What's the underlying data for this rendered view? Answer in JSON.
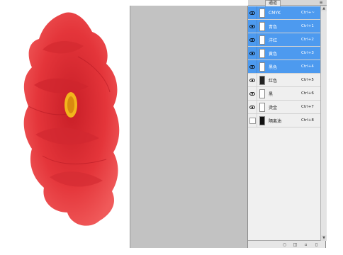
{
  "panel": {
    "tab_label": "通道",
    "menu_icon": "panel-menu-icon"
  },
  "channels": [
    {
      "name": "CMYK",
      "shortcut": "Ctrl+~",
      "selected": true,
      "visible": true
    },
    {
      "name": "青色",
      "shortcut": "Ctrl+1",
      "selected": true,
      "visible": true
    },
    {
      "name": "洋红",
      "shortcut": "Ctrl+2",
      "selected": true,
      "visible": true
    },
    {
      "name": "黄色",
      "shortcut": "Ctrl+3",
      "selected": true,
      "visible": true
    },
    {
      "name": "黑色",
      "shortcut": "Ctrl+4",
      "selected": true,
      "visible": true
    },
    {
      "name": "红色",
      "shortcut": "Ctrl+5",
      "selected": false,
      "visible": true
    },
    {
      "name": "黑",
      "shortcut": "Ctrl+6",
      "selected": false,
      "visible": true
    },
    {
      "name": "烫金",
      "shortcut": "Ctrl+7",
      "selected": false,
      "visible": true
    },
    {
      "name": "隔离油",
      "shortcut": "Ctrl+8",
      "selected": false,
      "visible": false
    }
  ],
  "colors": {
    "selection": "#4d9aef",
    "flower": "#e8343a"
  }
}
